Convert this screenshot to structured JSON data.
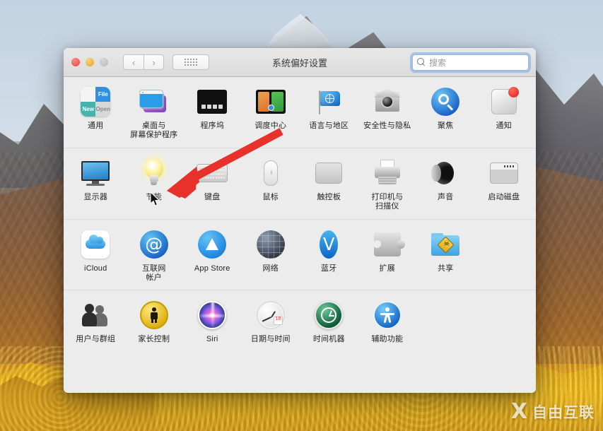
{
  "window": {
    "title": "系统偏好设置",
    "traffic_lights": [
      "close-button",
      "minimize-button",
      "maximize-button"
    ],
    "nav_back": "‹",
    "nav_forward": "›",
    "grid_button": "show-all-grid-button"
  },
  "search": {
    "placeholder": "搜索",
    "value": "",
    "icon": "search-icon"
  },
  "rows": [
    {
      "panes": [
        {
          "label": "通用",
          "icon": "general-icon",
          "tiles": [
            "",
            "File",
            "New",
            "Open"
          ]
        },
        {
          "label": "桌面与\n屏幕保护程序",
          "icon": "desktop-screensaver-icon"
        },
        {
          "label": "程序坞",
          "icon": "dock-icon"
        },
        {
          "label": "调度中心",
          "icon": "mission-control-icon"
        },
        {
          "label": "语言与地区",
          "icon": "language-region-icon"
        },
        {
          "label": "安全性与隐私",
          "icon": "security-privacy-icon"
        },
        {
          "label": "聚焦",
          "icon": "spotlight-icon"
        },
        {
          "label": "通知",
          "icon": "notifications-icon",
          "badge": true
        }
      ]
    },
    {
      "panes": [
        {
          "label": "显示器",
          "icon": "displays-icon"
        },
        {
          "label": "节能",
          "icon": "energy-saver-icon"
        },
        {
          "label": "键盘",
          "icon": "keyboard-icon"
        },
        {
          "label": "鼠标",
          "icon": "mouse-icon"
        },
        {
          "label": "触控板",
          "icon": "trackpad-icon"
        },
        {
          "label": "打印机与\n扫描仪",
          "icon": "printers-scanners-icon"
        },
        {
          "label": "声音",
          "icon": "sound-icon"
        },
        {
          "label": "启动磁盘",
          "icon": "startup-disk-icon"
        }
      ]
    },
    {
      "panes": [
        {
          "label": "iCloud",
          "icon": "icloud-icon"
        },
        {
          "label": "互联网\n帐户",
          "icon": "internet-accounts-icon"
        },
        {
          "label": "App Store",
          "icon": "app-store-icon"
        },
        {
          "label": "网络",
          "icon": "network-icon"
        },
        {
          "label": "蓝牙",
          "icon": "bluetooth-icon"
        },
        {
          "label": "扩展",
          "icon": "extensions-icon"
        },
        {
          "label": "共享",
          "icon": "sharing-icon"
        }
      ]
    },
    {
      "panes": [
        {
          "label": "用户与群组",
          "icon": "users-groups-icon"
        },
        {
          "label": "家长控制",
          "icon": "parental-controls-icon"
        },
        {
          "label": "Siri",
          "icon": "siri-icon"
        },
        {
          "label": "日期与时间",
          "icon": "date-time-icon"
        },
        {
          "label": "时间机器",
          "icon": "time-machine-icon"
        },
        {
          "label": "辅助功能",
          "icon": "accessibility-icon"
        }
      ]
    }
  ],
  "annotation": {
    "arrow_color": "#e8312a",
    "points_at": "节能"
  },
  "watermark": {
    "logo": "X",
    "text": "自由互联"
  },
  "colors": {
    "accent_blue": "#2f8fe0",
    "window_bg": "#ececec",
    "titlebar_bg": "#e4e3e3",
    "badge_red": "#d81d1d"
  }
}
